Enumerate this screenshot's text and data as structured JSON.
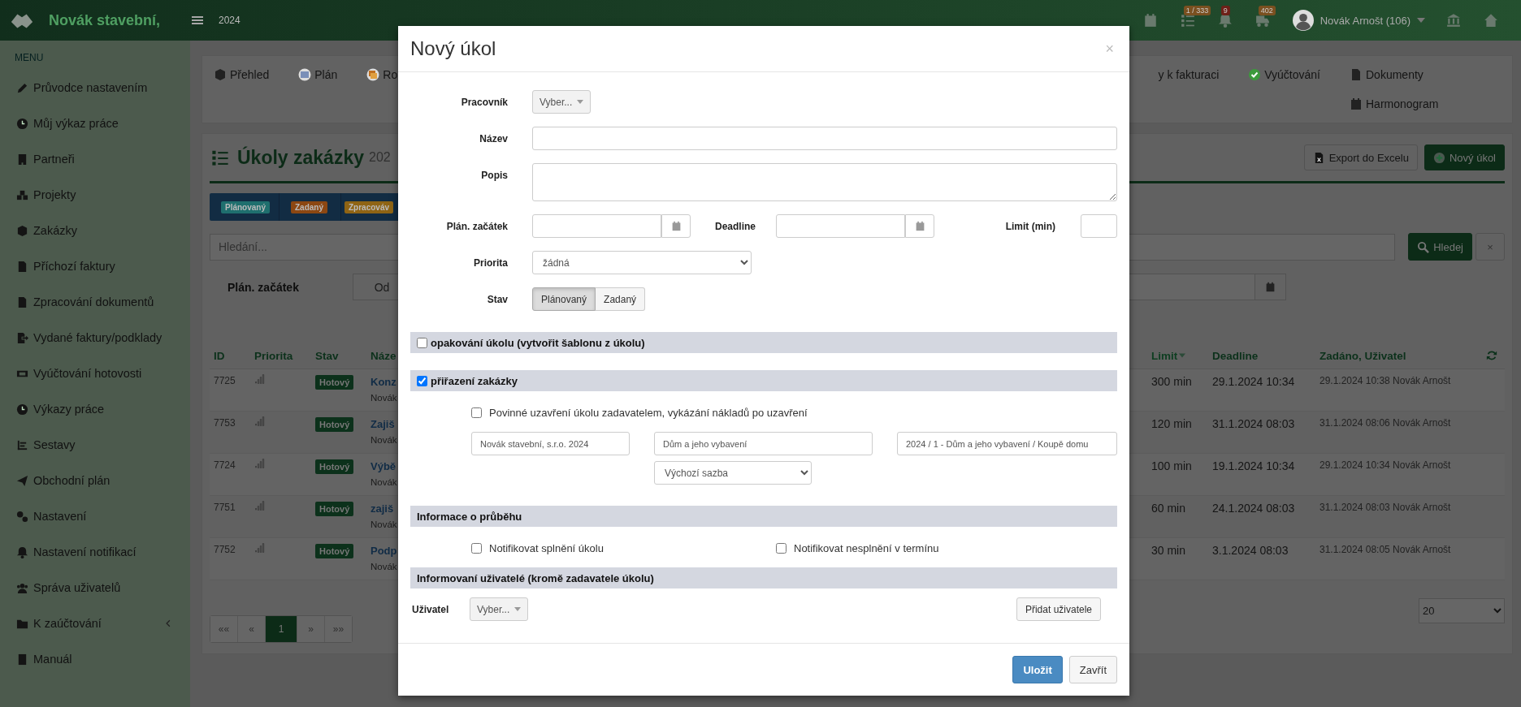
{
  "topbar": {
    "brand": "Novák stavební,",
    "year": "2024",
    "badges": [
      {
        "text": "1 / 333",
        "color": "#7a5020"
      },
      {
        "text": "9",
        "color": "#6e2018"
      },
      {
        "text": "402",
        "color": "#7a5020"
      }
    ],
    "user": "Novák Arnošt (106)"
  },
  "sidebar": {
    "heading": "MENU",
    "items": [
      {
        "label": "Průvodce nastavením",
        "kind": "link"
      },
      {
        "label": "Můj výkaz práce",
        "kind": "link"
      },
      {
        "label": "Partneři",
        "kind": "link"
      },
      {
        "label": "Projekty",
        "kind": "link"
      },
      {
        "label": "Zakázky",
        "kind": "link"
      },
      {
        "label": "Příchozí faktury",
        "kind": "link"
      },
      {
        "label": "Zpracování dokumentů",
        "kind": "link"
      },
      {
        "label": "Vydané faktury/podklady",
        "kind": "link"
      },
      {
        "label": "Vyúčtování hotovosti",
        "kind": "link"
      },
      {
        "label": "Výkazy práce",
        "kind": "link"
      },
      {
        "label": "Sestavy",
        "kind": "link"
      },
      {
        "label": "Obchodní plán",
        "kind": "link"
      },
      {
        "label": "Nastavení",
        "kind": "link"
      },
      {
        "label": "Nastavení notifikací",
        "kind": "link"
      },
      {
        "label": "Správa uživatelů",
        "kind": "link"
      },
      {
        "label": "K zaúčtování",
        "kind": "group"
      },
      {
        "label": "Manuál",
        "kind": "link"
      }
    ]
  },
  "nav": {
    "left": [
      "Přehled",
      "Plán",
      "Ro"
    ],
    "right": [
      "y k fakturaci",
      "Vyúčtování",
      "Dokumenty",
      "Harmonogram"
    ]
  },
  "page": {
    "title": "Úkoly zakázky",
    "subtitle": "202",
    "export_button": "Export do Excelu",
    "new_button": "Nový úkol"
  },
  "status_filter": [
    {
      "label": "Plánovaný",
      "color": "#1f6f6e"
    },
    {
      "label": "Zadaný",
      "color": "#8c4712"
    },
    {
      "label": "Zpracováv",
      "color": "#8f6414"
    }
  ],
  "search": {
    "placeholder": "Hledání...",
    "button": "Hledej",
    "clear": "×"
  },
  "date_filter": {
    "label": "Plán. začátek",
    "addon": "Od"
  },
  "table": {
    "columns": [
      {
        "label": "ID",
        "sorted": false
      },
      {
        "label": "Priorita",
        "sorted": false
      },
      {
        "label": "Stav",
        "sorted": false
      },
      {
        "label": "Náze",
        "sorted": false
      },
      {
        "label": "Limit",
        "sorted": true
      },
      {
        "label": "Deadline",
        "sorted": false
      },
      {
        "label": "Zadáno, Uživatel",
        "sorted": false
      }
    ],
    "rows": [
      {
        "id": "7725",
        "status": "Hotový",
        "name": "Konz",
        "owner": "Novák",
        "limit": "300 min",
        "deadline": "29.1.2024 10:34",
        "assigned": "29.1.2024 10:38 Novák Arnošt"
      },
      {
        "id": "7753",
        "status": "Hotový",
        "name": "Zajiš",
        "owner": "Novák",
        "limit": "120 min",
        "deadline": "31.1.2024 08:03",
        "assigned": "31.1.2024 08:06 Novák Arnošt"
      },
      {
        "id": "7724",
        "status": "Hotový",
        "name": "Výbě",
        "owner": "Novák",
        "limit": "100 min",
        "deadline": "19.1.2024 10:34",
        "assigned": "29.1.2024 10:34 Novák Arnošt"
      },
      {
        "id": "7751",
        "status": "Hotový",
        "name": "zajiš",
        "owner": "Novák",
        "limit": "60 min",
        "deadline": "24.1.2024 08:03",
        "assigned": "31.1.2024 08:03 Novák Arnošt"
      },
      {
        "id": "7752",
        "status": "Hotový",
        "name": "Podp",
        "owner": "Novák",
        "limit": "30 min",
        "deadline": "3.1.2024 08:03",
        "assigned": "31.1.2024 08:05 Novák Arnošt"
      }
    ]
  },
  "pagination": [
    {
      "label": "««",
      "selected": false
    },
    {
      "label": "«",
      "selected": false
    },
    {
      "label": "1",
      "selected": true
    },
    {
      "label": "»",
      "selected": false
    },
    {
      "label": "»»",
      "selected": false
    }
  ],
  "page_size": "20",
  "modal": {
    "title": "Nový úkol",
    "close": "×",
    "worker": {
      "label": "Pracovník",
      "value": "Vyber..."
    },
    "name_label": "Název",
    "description_label": "Popis",
    "plan_start_label": "Plán. začátek",
    "deadline_label": "Deadline",
    "limit_label": "Limit (min)",
    "priority": {
      "label": "Priorita",
      "value": "žádná"
    },
    "state": {
      "label": "Stav",
      "options": [
        {
          "label": "Plánovaný",
          "selected": true
        },
        {
          "label": "Zadaný",
          "selected": false
        }
      ]
    },
    "repeat": {
      "label": "opakování úkolu (vytvořit šablonu z úkolu)",
      "checked": false
    },
    "assignment": {
      "label": "přiřazení zakázky",
      "checked": true,
      "mandatory": {
        "label": "Povinné uzavření úkolu zadavatelem, vykázání nákladů po uzavření",
        "checked": false
      },
      "fields": [
        "Novák stavební, s.r.o. 2024",
        "Dům a jeho vybavení",
        "2024 / 1 - Dům a jeho vybavení / Koupě domu"
      ],
      "rate": "Výchozí sazba"
    },
    "progress": {
      "title": "Informace o průběhu",
      "options": [
        {
          "label": "Notifikovat splnění úkolu",
          "checked": false
        },
        {
          "label": "Notifikovat nesplnění v termínu",
          "checked": false
        }
      ]
    },
    "users": {
      "title": "Informovaní uživatelé (kromě zadavatele úkolu)",
      "label": "Uživatel",
      "value": "Vyber...",
      "add_button": "Přidat uživatele"
    },
    "buttons": [
      {
        "label": "Uložit",
        "kind": "primary"
      },
      {
        "label": "Zavřít",
        "kind": "default"
      }
    ]
  }
}
